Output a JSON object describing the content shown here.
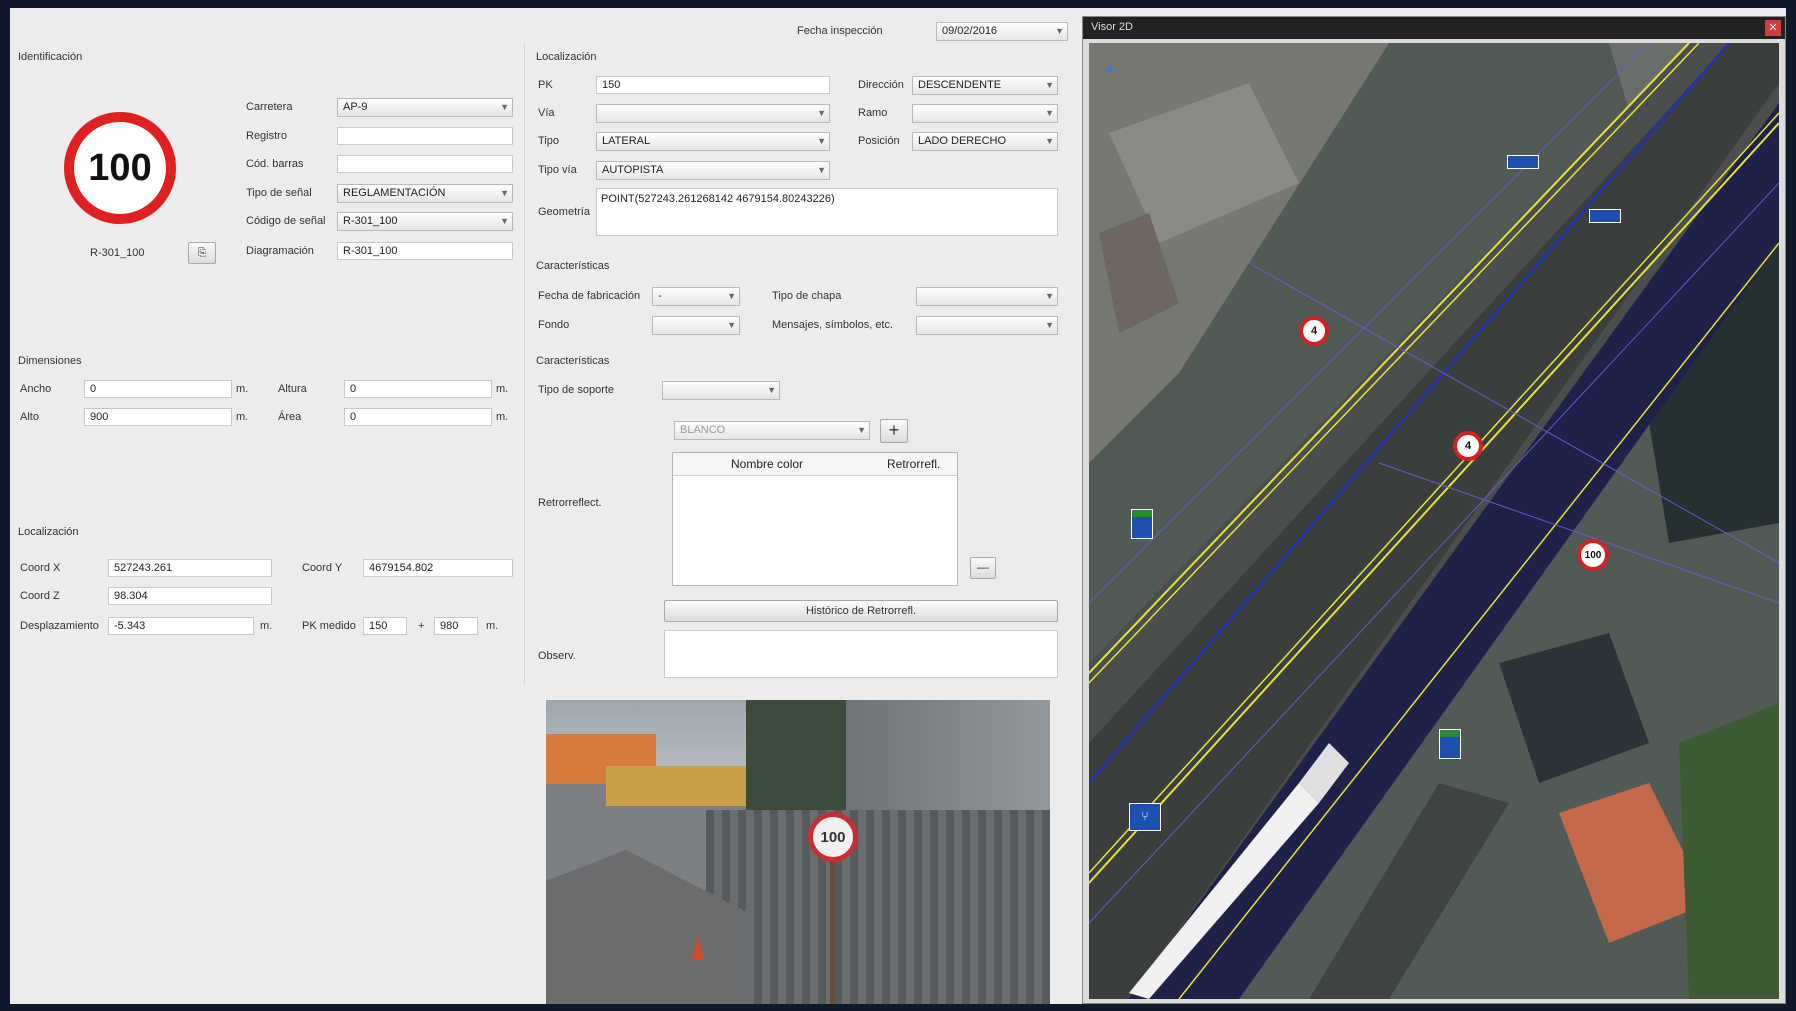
{
  "form": {
    "fecha_inspeccion_label": "Fecha inspección",
    "fecha_inspeccion_value": "09/02/2016",
    "identificacion": {
      "section_label": "Identificación",
      "sign_text": "100",
      "sign_code": "R-301_100",
      "carretera_label": "Carretera",
      "carretera_value": "AP-9",
      "registro_label": "Registro",
      "registro_value": "",
      "cod_barras_label": "Cód. barras",
      "cod_barras_value": "",
      "tipo_senal_label": "Tipo de señal",
      "tipo_senal_value": "REGLAMENTACIÓN",
      "codigo_senal_label": "Código de señal",
      "codigo_senal_value": "R-301_100",
      "diagramacion_label": "Diagramación",
      "diagramacion_value": "R-301_100"
    },
    "dimensiones": {
      "section_label": "Dimensiones",
      "ancho_label": "Ancho",
      "ancho_value": "0",
      "alto_label": "Alto",
      "alto_value": "900",
      "altura_label": "Altura",
      "altura_value": "0",
      "area_label": "Área",
      "area_value": "0",
      "unit": "m."
    },
    "localizacion_left": {
      "section_label": "Localización",
      "coord_x_label": "Coord X",
      "coord_x_value": "527243.261",
      "coord_y_label": "Coord Y",
      "coord_y_value": "4679154.802",
      "coord_z_label": "Coord Z",
      "coord_z_value": "98.304",
      "desplazamiento_label": "Desplazamiento",
      "desplazamiento_value": "-5.343",
      "pk_medido_label": "PK medido",
      "pk_medido_value": "150",
      "plus": "+",
      "pk_medido_value2": "980",
      "unit": "m."
    },
    "localizacion_right": {
      "section_label": "Localización",
      "pk_label": "PK",
      "pk_value": "150",
      "via_label": "Vía",
      "via_value": "",
      "tipo_label": "Tipo",
      "tipo_value": "LATERAL",
      "tipo_via_label": "Tipo vía",
      "tipo_via_value": "AUTOPISTA",
      "direccion_label": "Dirección",
      "direccion_value": "DESCENDENTE",
      "ramo_label": "Ramo",
      "ramo_value": "",
      "posicion_label": "Posición",
      "posicion_value": "LADO DERECHO",
      "geometria_label": "Geometría",
      "geometria_value": "POINT(527243.261268142 4679154.80243226)"
    },
    "caracteristicas1": {
      "section_label": "Características",
      "fecha_fabricacion_label": "Fecha de fabricación",
      "fecha_fabricacion_value": "-",
      "fondo_label": "Fondo",
      "fondo_value": "",
      "tipo_chapa_label": "Tipo de chapa",
      "tipo_chapa_value": "",
      "mensajes_label": "Mensajes, símbolos, etc.",
      "mensajes_value": ""
    },
    "caracteristicas2": {
      "section_label": "Características",
      "tipo_soporte_label": "Tipo de soporte",
      "tipo_soporte_value": "",
      "color_value": "BLANCO",
      "retro_label": "Retrorreflect.",
      "table_headers": [
        "Nombre color",
        "Retrorrefl."
      ],
      "historico_button": "Histórico de Retrorrefl.",
      "add_symbol": "+",
      "remove_symbol": "—"
    },
    "observ_label": "Observ.",
    "observ_value": ""
  },
  "photo": {
    "sign_text": "100"
  },
  "map": {
    "title": "Visor 2D",
    "signs": [
      "4",
      "4",
      "100"
    ]
  },
  "colors": {
    "sign_red": "#e02020",
    "route_blue": "#1a2fd0",
    "lane_yellow": "#e8e23a",
    "panel_blue": "#1f4fb0"
  }
}
